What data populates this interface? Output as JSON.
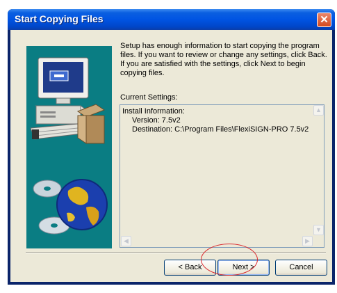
{
  "window": {
    "title": "Start Copying Files",
    "close_glyph": "✕"
  },
  "description": "Setup has enough information to start copying the program files. If you want to review or change any settings, click Back.  If you are satisfied with the settings, click Next to begin copying files.",
  "current_settings_label": "Current Settings:",
  "settings": {
    "heading": "Install Information:",
    "version": "Version: 7.5v2",
    "destination": "Destination: C:\\Program Files\\FlexiSIGN-PRO 7.5v2"
  },
  "scrollbar": {
    "up": "▲",
    "down": "▼",
    "left": "◀",
    "right": "▶"
  },
  "buttons": {
    "back": "< Back",
    "next": "Next >",
    "cancel": "Cancel"
  },
  "colors": {
    "titlebar": "#0054e3",
    "dialog_bg": "#ece9d8",
    "art_bg": "#0a7d83",
    "highlight_circle": "#d9252a"
  }
}
